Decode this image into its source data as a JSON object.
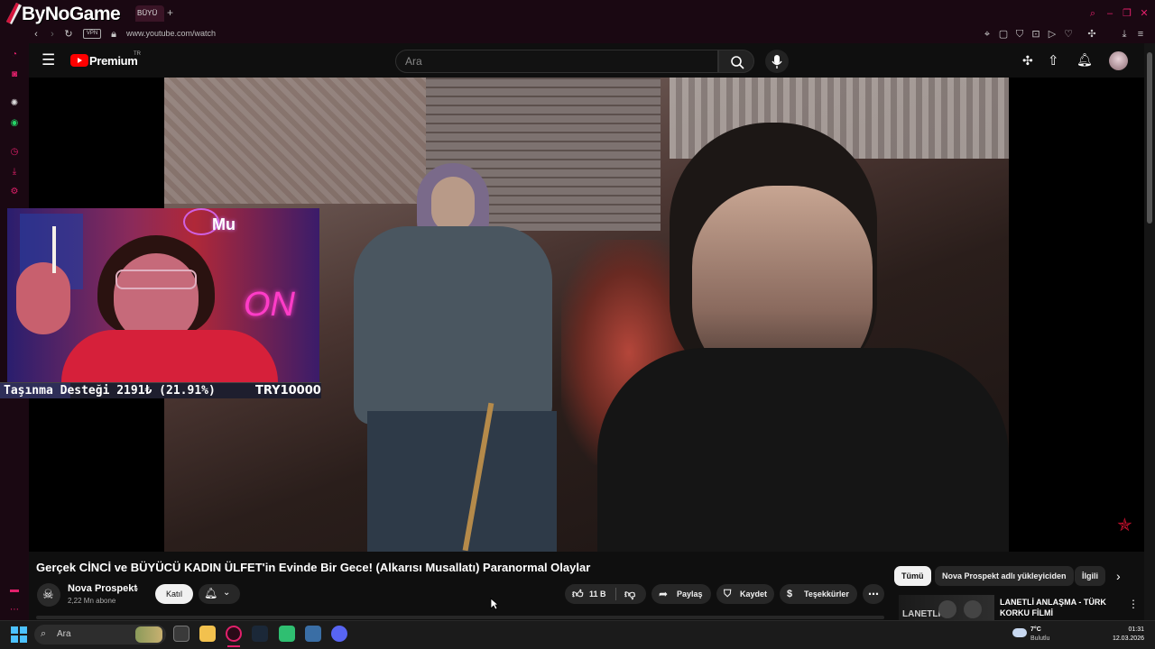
{
  "browser": {
    "watermark": "ByNoGame",
    "tab_label": "BÜYÜ",
    "new_tab": "+",
    "vpn_badge": "VPN",
    "url": "www.youtube.com/watch"
  },
  "youtube": {
    "logo_text": "Premium",
    "logo_sup": "TR",
    "search_placeholder": "Ara"
  },
  "stream_overlay": {
    "webcam_label": "Mu",
    "neon_sign": "ON",
    "donation_text": "Taşınma Desteği 2191₺ (21.91%)",
    "donation_target": "TRY10000",
    "donation_progress": 0.2191
  },
  "video": {
    "title": "Gerçek CİNCİ ve BÜYÜCÜ KADIN ÜLFET'in Evinde Bir Gece! (Alkarısı Musallatı) Paranormal Olaylar",
    "channel_name": "Nova Prospekt",
    "subscribers": "2,22 Mn abone",
    "join_label": "Katıl",
    "like_count": "11 B",
    "share_label": "Paylaş",
    "save_label": "Kaydet",
    "thanks_label": "Teşekkürler"
  },
  "related_chips": [
    "Tümü",
    "Nova Prospekt adlı yükleyiciden",
    "İlgili"
  ],
  "recommendation": {
    "title": "LANETLİ ANLAŞMA - TÜRK KORKU FİLMİ",
    "thumb_text": "LANETLI"
  },
  "taskbar": {
    "search_label": "Ara",
    "weather_temp": "7°C",
    "weather_desc": "Bulutlu",
    "time": "01:31",
    "date": "12.03.2026"
  }
}
